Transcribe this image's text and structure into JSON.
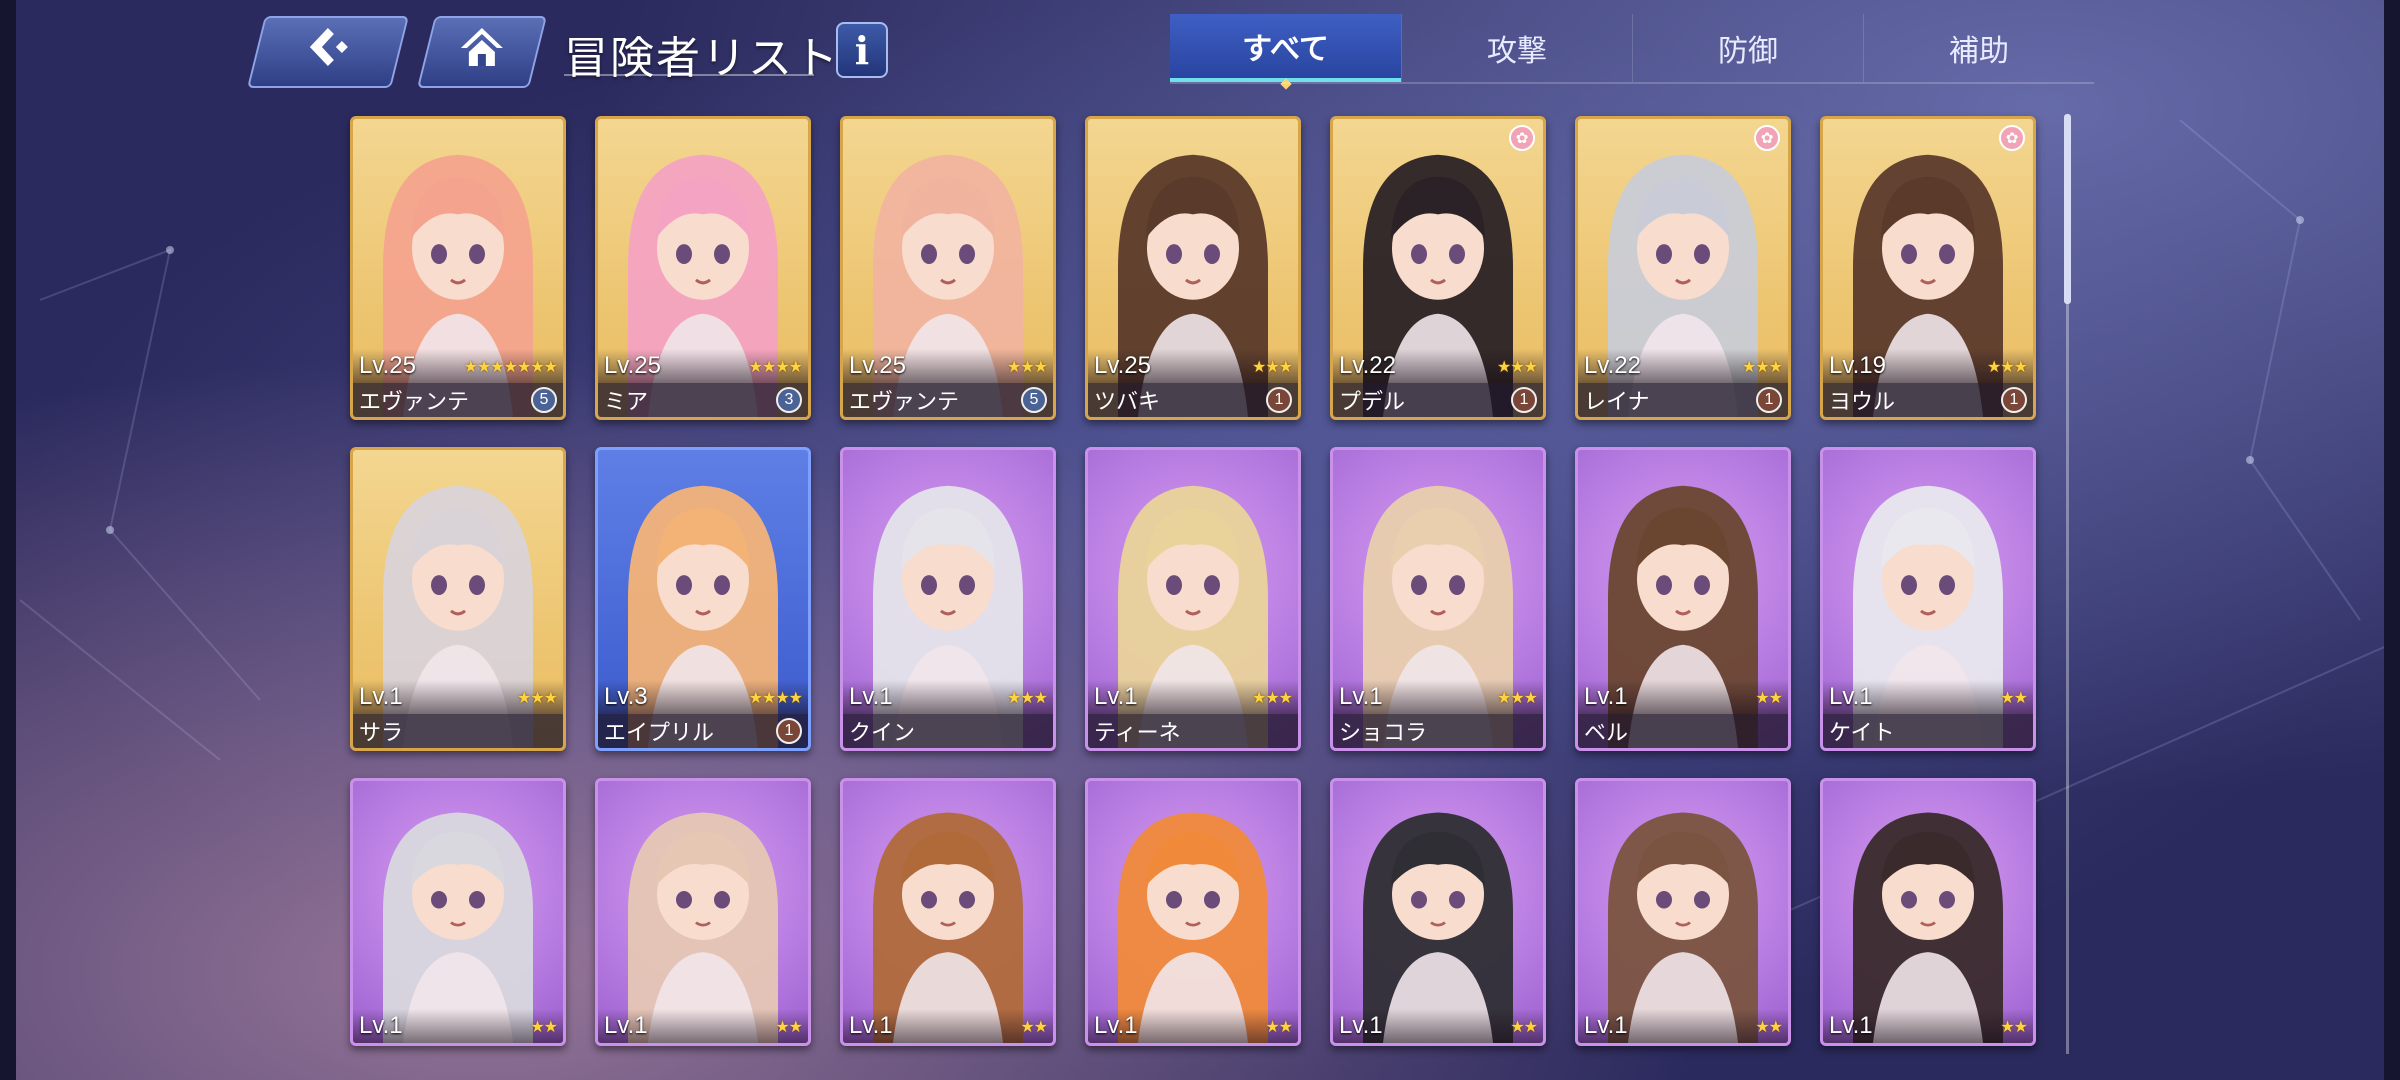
{
  "header": {
    "back_icon": "back-arrow-icon",
    "home_icon": "home-icon",
    "title": "冒険者リスト",
    "info_label": "i"
  },
  "tabs": [
    {
      "label": "すべて",
      "active": true
    },
    {
      "label": "攻撃",
      "active": false
    },
    {
      "label": "防御",
      "active": false
    },
    {
      "label": "補助",
      "active": false
    }
  ],
  "colors": {
    "gold_card": "#e9bb5f",
    "blue_card": "#3b5acd",
    "purple_card": "#b57ae0",
    "active_tab": "#3f5fc4",
    "accent": "#6fe0ee"
  },
  "rows": [
    [
      {
        "level": "Lv.25",
        "name": "エヴァンテ",
        "stars": "★★★★★★★",
        "badge": "5",
        "frame": "gold",
        "hair": "#f4a48e"
      },
      {
        "level": "Lv.25",
        "name": "ミア",
        "stars": "★★★★",
        "badge": "3",
        "frame": "gold",
        "hair": "#f4a3c2"
      },
      {
        "level": "Lv.25",
        "name": "エヴァンテ",
        "stars": "★★★",
        "badge": "5",
        "frame": "gold",
        "hair": "#f0b49e"
      },
      {
        "level": "Lv.25",
        "name": "ツバキ",
        "stars": "★★★",
        "badge": "1",
        "frame": "gold",
        "hair": "#5a3a2a"
      },
      {
        "level": "Lv.22",
        "name": "プデル",
        "stars": "★★★",
        "badge": "1",
        "frame": "gold",
        "hair": "#2a2226",
        "paw": true
      },
      {
        "level": "Lv.22",
        "name": "レイナ",
        "stars": "★★★",
        "badge": "1",
        "frame": "gold",
        "hair": "#c9ccd6",
        "paw": true
      },
      {
        "level": "Lv.19",
        "name": "ヨウル",
        "stars": "★★★",
        "badge": "1",
        "frame": "gold",
        "hair": "#5b3a2c",
        "paw": true
      }
    ],
    [
      {
        "level": "Lv.1",
        "name": "サラ",
        "stars": "★★★",
        "badge": "",
        "frame": "gold",
        "hair": "#d9d3d8"
      },
      {
        "level": "Lv.3",
        "name": "エイプリル",
        "stars": "★★★★",
        "badge": "1",
        "frame": "blue",
        "hair": "#f3b377"
      },
      {
        "level": "Lv.1",
        "name": "クイン",
        "stars": "★★★",
        "badge": "",
        "frame": "purple",
        "hair": "#e4e4ea"
      },
      {
        "level": "Lv.1",
        "name": "ティーネ",
        "stars": "★★★",
        "badge": "",
        "frame": "purple",
        "hair": "#ead39a"
      },
      {
        "level": "Lv.1",
        "name": "ショコラ",
        "stars": "★★★",
        "badge": "",
        "frame": "purple",
        "hair": "#e9cfae"
      },
      {
        "level": "Lv.1",
        "name": "ベル",
        "stars": "★★",
        "badge": "",
        "frame": "purple",
        "hair": "#6a4630"
      },
      {
        "level": "Lv.1",
        "name": "ケイト",
        "stars": "★★",
        "badge": "",
        "frame": "purple",
        "hair": "#e8e8ee"
      }
    ],
    [
      {
        "level": "Lv.1",
        "stars": "★★",
        "frame": "purple",
        "hair": "#d8d8de"
      },
      {
        "level": "Lv.1",
        "stars": "★★",
        "frame": "purple",
        "hair": "#e6c7b4"
      },
      {
        "level": "Lv.1",
        "stars": "★★",
        "frame": "purple",
        "hair": "#b06a3a"
      },
      {
        "level": "Lv.1",
        "stars": "★★",
        "frame": "purple",
        "hair": "#f08a3a"
      },
      {
        "level": "Lv.1",
        "stars": "★★",
        "frame": "purple",
        "hair": "#2e2e34"
      },
      {
        "level": "Lv.1",
        "stars": "★★",
        "frame": "purple",
        "hair": "#7a5440"
      },
      {
        "level": "Lv.1",
        "stars": "★★",
        "frame": "purple",
        "hair": "#3a2a2c"
      }
    ]
  ]
}
